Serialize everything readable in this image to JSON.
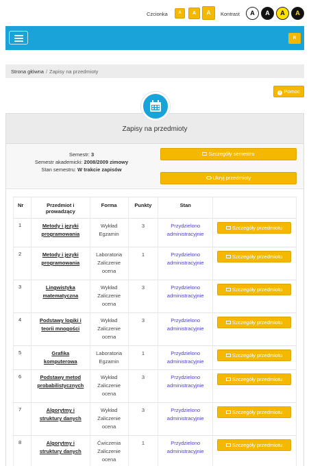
{
  "accessibility": {
    "font_label": "Czcionka",
    "font_buttons": [
      "A",
      "A",
      "A"
    ],
    "contrast_label": "Kontrast",
    "contrast_buttons": [
      "A",
      "A",
      "A",
      "A"
    ]
  },
  "navbar": {
    "right_button_label": "R"
  },
  "breadcrumb": {
    "home": "Strona główna",
    "separator": "/",
    "current": "Zapisy na przedmioty"
  },
  "help": {
    "label": "Pomoc"
  },
  "card": {
    "title": "Zapisy na przedmioty",
    "semester_label": "Semestr:",
    "semester_value": "3",
    "academic_label": "Semestr akademicki:",
    "academic_value": "2008/2009 zimowy",
    "state_label": "Stan semestru:",
    "state_value": "W trakcie zapisów",
    "semester_details_button": "Szczegóły semestru",
    "hide_subjects_button": "Ukryj przedmioty"
  },
  "table": {
    "headers": {
      "nr": "Nr",
      "subject_l1": "Przedmiot i",
      "subject_l2": "prowadzący",
      "forma": "Forma",
      "punkty": "Punkty",
      "stan": "Stan"
    },
    "rows": [
      {
        "nr": "1",
        "subject1": "Metody i języki",
        "subject2": "programowania",
        "forma1": "Wykład",
        "forma2": "Egzamin",
        "forma3": "",
        "punkty": "3",
        "stan1": "Przydzielono",
        "stan2": "administracyjnie",
        "action": "Szczegóły przedmiotu"
      },
      {
        "nr": "2",
        "subject1": "Metody i języki",
        "subject2": "programowania",
        "forma1": "Laboratoria",
        "forma2": "Zaliczenie",
        "forma3": "ocena",
        "punkty": "1",
        "stan1": "Przydzielono",
        "stan2": "administracyjnie",
        "action": "Szczegóły przedmiotu"
      },
      {
        "nr": "3",
        "subject1": "Lingwistyka",
        "subject2": "matematyczna",
        "forma1": "Wykład",
        "forma2": "Zaliczenie",
        "forma3": "ocena",
        "punkty": "3",
        "stan1": "Przydzielono",
        "stan2": "administracyjnie",
        "action": "Szczegóły przedmiotu"
      },
      {
        "nr": "4",
        "subject1": "Podstawy logiki i",
        "subject2": "teorii mnogości",
        "forma1": "Wykład",
        "forma2": "Zaliczenie",
        "forma3": "ocena",
        "punkty": "3",
        "stan1": "Przydzielono",
        "stan2": "administracyjnie",
        "action": "Szczegóły przedmiotu"
      },
      {
        "nr": "5",
        "subject1": "Grafika",
        "subject2": "komputerowa",
        "forma1": "Laboratoria",
        "forma2": "Egzamin",
        "forma3": "",
        "punkty": "1",
        "stan1": "Przydzielono",
        "stan2": "administracyjnie",
        "action": "Szczegóły przedmiotu"
      },
      {
        "nr": "6",
        "subject1": "Podstawy metod",
        "subject2": "probabilistycznych",
        "forma1": "Wykład",
        "forma2": "Zaliczenie",
        "forma3": "ocena",
        "punkty": "3",
        "stan1": "Przydzielono",
        "stan2": "administracyjnie",
        "action": "Szczegóły przedmiotu"
      },
      {
        "nr": "7",
        "subject1": "Algorytmy i",
        "subject2": "struktury danych",
        "forma1": "Wykład",
        "forma2": "Zaliczenie",
        "forma3": "ocena",
        "punkty": "3",
        "stan1": "Przydzielono",
        "stan2": "administracyjnie",
        "action": "Szczegóły przedmiotu"
      },
      {
        "nr": "8",
        "subject1": "Algorytmy i",
        "subject2": "struktury danych",
        "forma1": "Ćwiczenia",
        "forma2": "Zaliczenie",
        "forma3": "ocena",
        "punkty": "1",
        "stan1": "Przydzielono",
        "stan2": "administracyjnie",
        "action": "Szczegóły przedmiotu"
      }
    ]
  },
  "colors": {
    "accent": "#1aa3d9",
    "button": "#f5b800",
    "status": "#4a3fd0"
  }
}
